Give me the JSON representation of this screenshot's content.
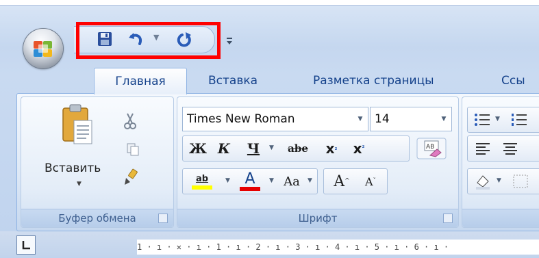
{
  "colors": {
    "accent": "#15428b",
    "highlight_box": "#ff0000",
    "font_color_bar": "#e60000",
    "text_highlight_bar": "#ffff00"
  },
  "quick_access_toolbar": {
    "save_icon": "save-icon",
    "undo_icon": "undo-icon",
    "redo_icon": "redo-icon",
    "customize_icon": "customize-qat-icon"
  },
  "tabs": [
    {
      "label": "Главная",
      "active": true
    },
    {
      "label": "Вставка",
      "active": false
    },
    {
      "label": "Разметка страницы",
      "active": false
    },
    {
      "label": "Ссы",
      "active": false
    }
  ],
  "clipboard": {
    "paste_label": "Вставить",
    "group_label": "Буфер обмена"
  },
  "font": {
    "font_name": "Times New Roman",
    "font_size": "14",
    "group_label": "Шрифт",
    "bold": "Ж",
    "italic": "К",
    "underline": "Ч",
    "strike": "abe",
    "subscript": "x",
    "superscript": "x",
    "highlight": "ab",
    "font_color": "A",
    "change_case": "Aa",
    "grow": "A",
    "shrink": "A"
  },
  "ruler": {
    "text": "1 · ı · ✕ · ı · 1 · ı · 2 · ı · 3 · ı · 4 · ı · 5 · ı · 6 · ı ·"
  }
}
